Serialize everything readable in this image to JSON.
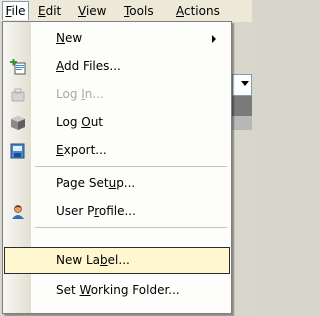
{
  "menubar": {
    "items": [
      {
        "label": "File",
        "accel": "F",
        "rest": "ile"
      },
      {
        "label": "Edit",
        "accel": "E",
        "rest": "dit"
      },
      {
        "label": "View",
        "accel": "V",
        "rest": "iew"
      },
      {
        "label": "Tools",
        "accel": "T",
        "rest": "ools"
      },
      {
        "label": "Actions",
        "accel": "A",
        "rest": "ctions"
      }
    ]
  },
  "file_menu": {
    "items": [
      {
        "pre": "",
        "accel": "N",
        "post": "ew",
        "icon": "none",
        "disabled": false,
        "submenu": true
      },
      {
        "pre": "",
        "accel": "A",
        "post": "dd Files...",
        "icon": "add-files-icon",
        "disabled": false
      },
      {
        "pre": "Log ",
        "accel": "I",
        "post": "n...",
        "icon": "log-in-icon",
        "disabled": true
      },
      {
        "pre": "Log ",
        "accel": "O",
        "post": "ut",
        "icon": "log-out-icon",
        "disabled": false
      },
      {
        "pre": "",
        "accel": "E",
        "post": "xport...",
        "icon": "export-icon",
        "disabled": false
      },
      {
        "pre": "Page Set",
        "accel": "u",
        "post": "p...",
        "icon": "none",
        "disabled": false
      },
      {
        "pre": "User P",
        "accel": "r",
        "post": "ofile...",
        "icon": "user-profile-icon",
        "disabled": false
      },
      {
        "pre": "New La",
        "accel": "b",
        "post": "el...",
        "icon": "none",
        "disabled": false,
        "highlighted": true
      },
      {
        "pre": "Set ",
        "accel": "W",
        "post": "orking Folder...",
        "icon": "none",
        "disabled": false
      }
    ]
  },
  "colors": {
    "highlight_bg": "#fff7d0",
    "highlight_border": "#2b2b2b",
    "disabled_text": "#a8a8a8"
  }
}
